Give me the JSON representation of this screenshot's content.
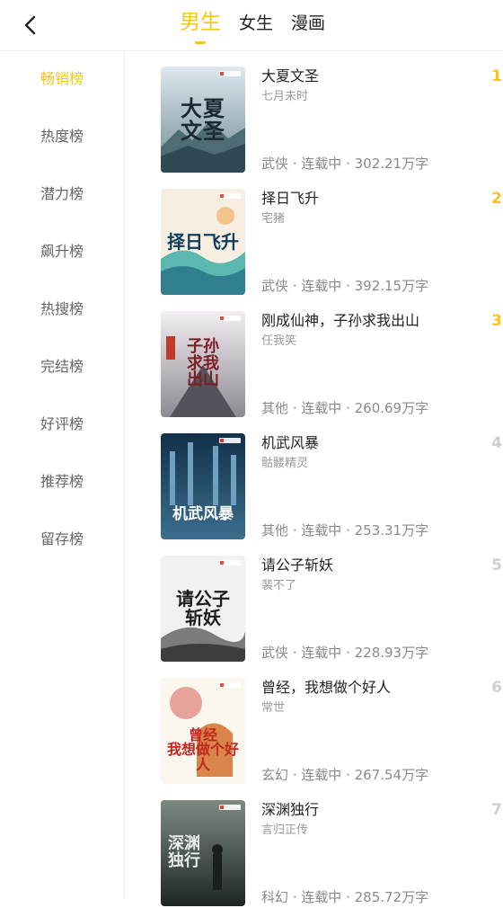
{
  "header": {
    "tabs": [
      {
        "label": "男生",
        "active": true
      },
      {
        "label": "女生",
        "active": false
      },
      {
        "label": "漫画",
        "active": false
      }
    ],
    "accent_color": "#f5c518",
    "back_icon": "chevron-left-icon"
  },
  "sidebar": {
    "items": [
      {
        "label": "畅销榜",
        "active": true
      },
      {
        "label": "热度榜",
        "active": false
      },
      {
        "label": "潜力榜",
        "active": false
      },
      {
        "label": "飙升榜",
        "active": false
      },
      {
        "label": "热搜榜",
        "active": false
      },
      {
        "label": "完结榜",
        "active": false
      },
      {
        "label": "好评榜",
        "active": false
      },
      {
        "label": "推荐榜",
        "active": false
      },
      {
        "label": "留存榜",
        "active": false
      }
    ]
  },
  "books": [
    {
      "rank": "1",
      "title": "大夏文圣",
      "author": "七月未时",
      "meta": "武侠 · 连载中 · 302.21万字",
      "cover_text": "大夏文圣"
    },
    {
      "rank": "2",
      "title": "择日飞升",
      "author": "宅猪",
      "meta": "武侠 · 连载中 · 392.15万字",
      "cover_text": "择日飞升"
    },
    {
      "rank": "3",
      "title": "刚成仙神，子孙求我出山",
      "author": "任我笑",
      "meta": "其他 · 连载中 · 260.69万字",
      "cover_text": "子孙求我出山"
    },
    {
      "rank": "4",
      "title": "机武风暴",
      "author": "骷髅精灵",
      "meta": "其他 · 连载中 · 253.31万字",
      "cover_text": "机武风暴"
    },
    {
      "rank": "5",
      "title": "请公子斩妖",
      "author": "裴不了",
      "meta": "武侠 · 连载中 · 228.93万字",
      "cover_text": "请公子斩妖"
    },
    {
      "rank": "6",
      "title": "曾经，我想做个好人",
      "author": "常世",
      "meta": "玄幻 · 连载中 · 267.54万字",
      "cover_text": "曾经我想做个好人"
    },
    {
      "rank": "7",
      "title": "深渊独行",
      "author": "言归正传",
      "meta": "科幻 · 连载中 · 285.72万字",
      "cover_text": "深渊独行"
    }
  ]
}
